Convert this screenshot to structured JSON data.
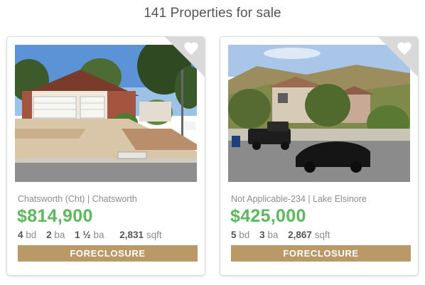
{
  "header": {
    "title": "141 Properties for sale"
  },
  "colors": {
    "price": "#5cb85c",
    "badge": "#b99a67",
    "corner": "#d9d9d9"
  },
  "listings": [
    {
      "location": "Chatsworth (Cht) | Chatsworth",
      "price": "$814,900",
      "beds": "4",
      "beds_unit": "bd",
      "baths": "2",
      "baths_unit": "ba",
      "half_baths": "1 ½",
      "half_baths_unit": "ba",
      "sqft": "2,831",
      "sqft_unit": "sqft",
      "status": "FORECLOSURE",
      "favorite_icon": "heart-icon"
    },
    {
      "location": "Not Applicable-234 | Lake Elsinore",
      "price": "$425,000",
      "beds": "5",
      "beds_unit": "bd",
      "baths": "3",
      "baths_unit": "ba",
      "sqft": "2,867",
      "sqft_unit": "sqft",
      "status": "FORECLOSURE",
      "favorite_icon": "heart-icon"
    }
  ]
}
